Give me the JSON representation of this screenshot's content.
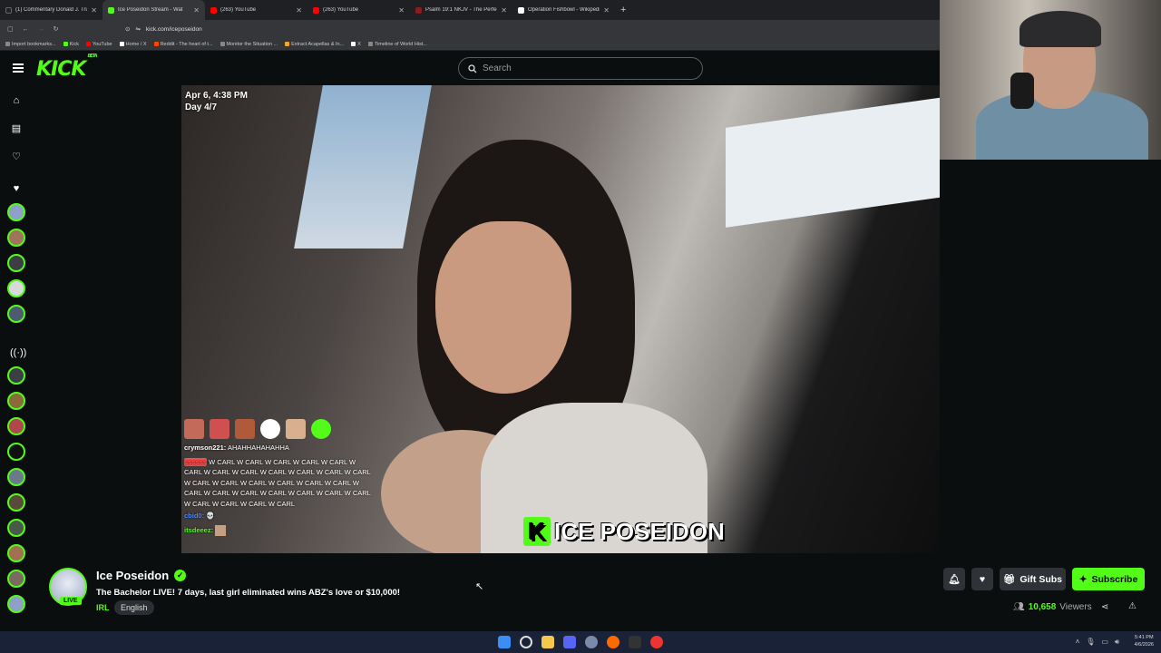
{
  "browser": {
    "tabs": [
      {
        "label": "(1) Commentary Donald J. Trum",
        "color": "#222"
      },
      {
        "label": "Ice Poseidon Stream - Wat",
        "color": "#53fc18",
        "active": true
      },
      {
        "label": "(263) YouTube",
        "color": "#ff0000"
      },
      {
        "label": "(263) YouTube",
        "color": "#ff0000"
      },
      {
        "label": "Psalm 19:1 NKJV - The Perfect",
        "color": "#8b1d1d"
      },
      {
        "label": "Operation Fishbowl - Wikipedia",
        "color": "#ffffff"
      }
    ],
    "url": "kick.com/iceposeidon",
    "bookmarks": [
      {
        "label": "Import bookmarks...",
        "color": "#888"
      },
      {
        "label": "Kick",
        "color": "#53fc18"
      },
      {
        "label": "YouTube",
        "color": "#ff0000"
      },
      {
        "label": "Home / X",
        "color": "#fff"
      },
      {
        "label": "Reddit - The heart of t...",
        "color": "#ff4500"
      },
      {
        "label": "Monitor the Situation ...",
        "color": "#888"
      },
      {
        "label": "Extract Acapellas & In...",
        "color": "#f5a623"
      },
      {
        "label": "X",
        "color": "#fff"
      },
      {
        "label": "Timeline of World Hist...",
        "color": "#888"
      }
    ]
  },
  "site": {
    "logo": "KICK",
    "logo_tag": "BETA",
    "search_placeholder": "Search"
  },
  "stream": {
    "overlay_date": "Apr 6, 4:38 PM",
    "overlay_day": "Day 4/7",
    "watermark": "ICE POSEIDON",
    "chat": [
      {
        "user": "crymson221:",
        "text": "AHAHHAHAHAHHA",
        "user_color": "#ffffff"
      },
      {
        "user": "",
        "text": "W CARL W CARL W CARL W CARL W CARL W CARL W CARL W CARL W CARL W CARL W CARL W CARL W CARL W CARL W CARL W CARL W CARL W CARL W CARL W CARL W CARL W CARL W CARL W CARL W CARL W CARL W CARL W CARL W CARL",
        "user_color": "#ff4d4d"
      },
      {
        "user": "cbid0:",
        "text": "",
        "user_color": "#4d8bff"
      },
      {
        "user": "itsdeeez:",
        "text": "",
        "user_color": "#53fc18"
      }
    ]
  },
  "channel": {
    "name": "Ice Poseidon",
    "live_badge": "LIVE",
    "title": "The Bachelor LIVE! 7 days, last girl eliminated wins ABZ's love or $10,000!",
    "category": "IRL",
    "language": "English",
    "gift_subs_label": "Gift Subs",
    "subscribe_label": "Subscribe",
    "viewers_count": "10,658",
    "viewers_label": "Viewers"
  },
  "taskbar": {
    "time": "5:41 PM",
    "date": "4/6/2026"
  }
}
